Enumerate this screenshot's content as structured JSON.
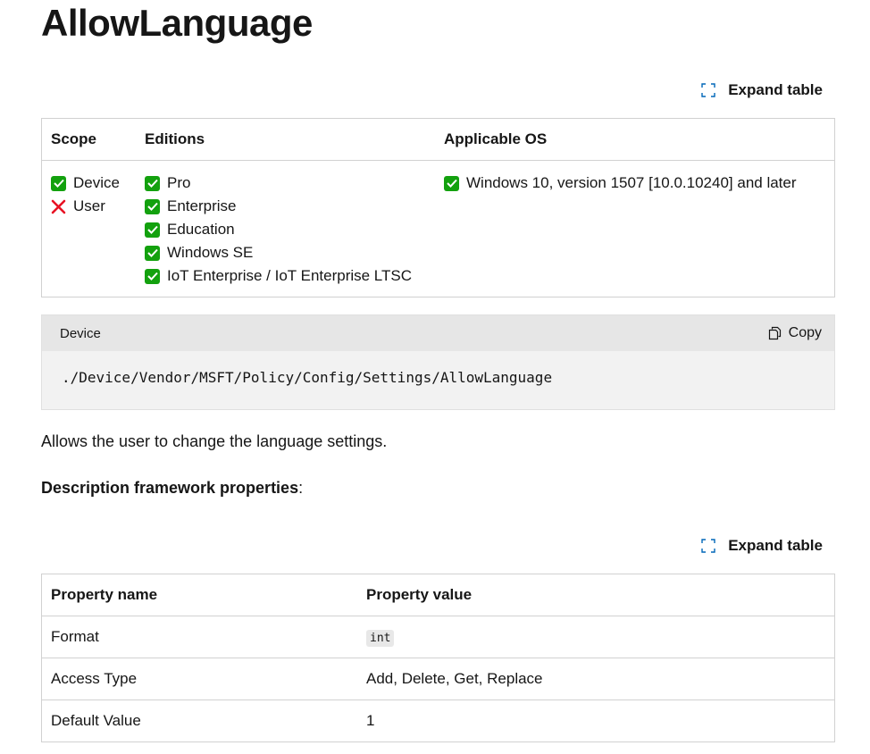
{
  "title": "AllowLanguage",
  "expand_table_label": "Expand table",
  "scope_table": {
    "headers": [
      "Scope",
      "Editions",
      "Applicable OS"
    ],
    "scope": [
      {
        "label": "Device",
        "enabled": true
      },
      {
        "label": "User",
        "enabled": false
      }
    ],
    "editions": [
      "Pro",
      "Enterprise",
      "Education",
      "Windows SE",
      "IoT Enterprise / IoT Enterprise LTSC"
    ],
    "os": [
      "Windows 10, version 1507 [10.0.10240] and later"
    ]
  },
  "code_block": {
    "label": "Device",
    "copy_label": "Copy",
    "code": "./Device/Vendor/MSFT/Policy/Config/Settings/AllowLanguage"
  },
  "description": "Allows the user to change the language settings.",
  "framework": {
    "heading": "Description framework properties",
    "heading_suffix": ":",
    "headers": [
      "Property name",
      "Property value"
    ],
    "rows": [
      {
        "name": "Format",
        "value": "int",
        "is_code": true
      },
      {
        "name": "Access Type",
        "value": "Add, Delete, Get, Replace",
        "is_code": false
      },
      {
        "name": "Default Value",
        "value": "1",
        "is_code": false
      }
    ]
  },
  "colors": {
    "check": "#13a10e",
    "cross": "#e81123",
    "accent": "#0067b8"
  },
  "icons": {
    "check": "checkmark-icon",
    "cross": "cross-icon",
    "expand": "expand-icon",
    "copy": "copy-icon"
  }
}
